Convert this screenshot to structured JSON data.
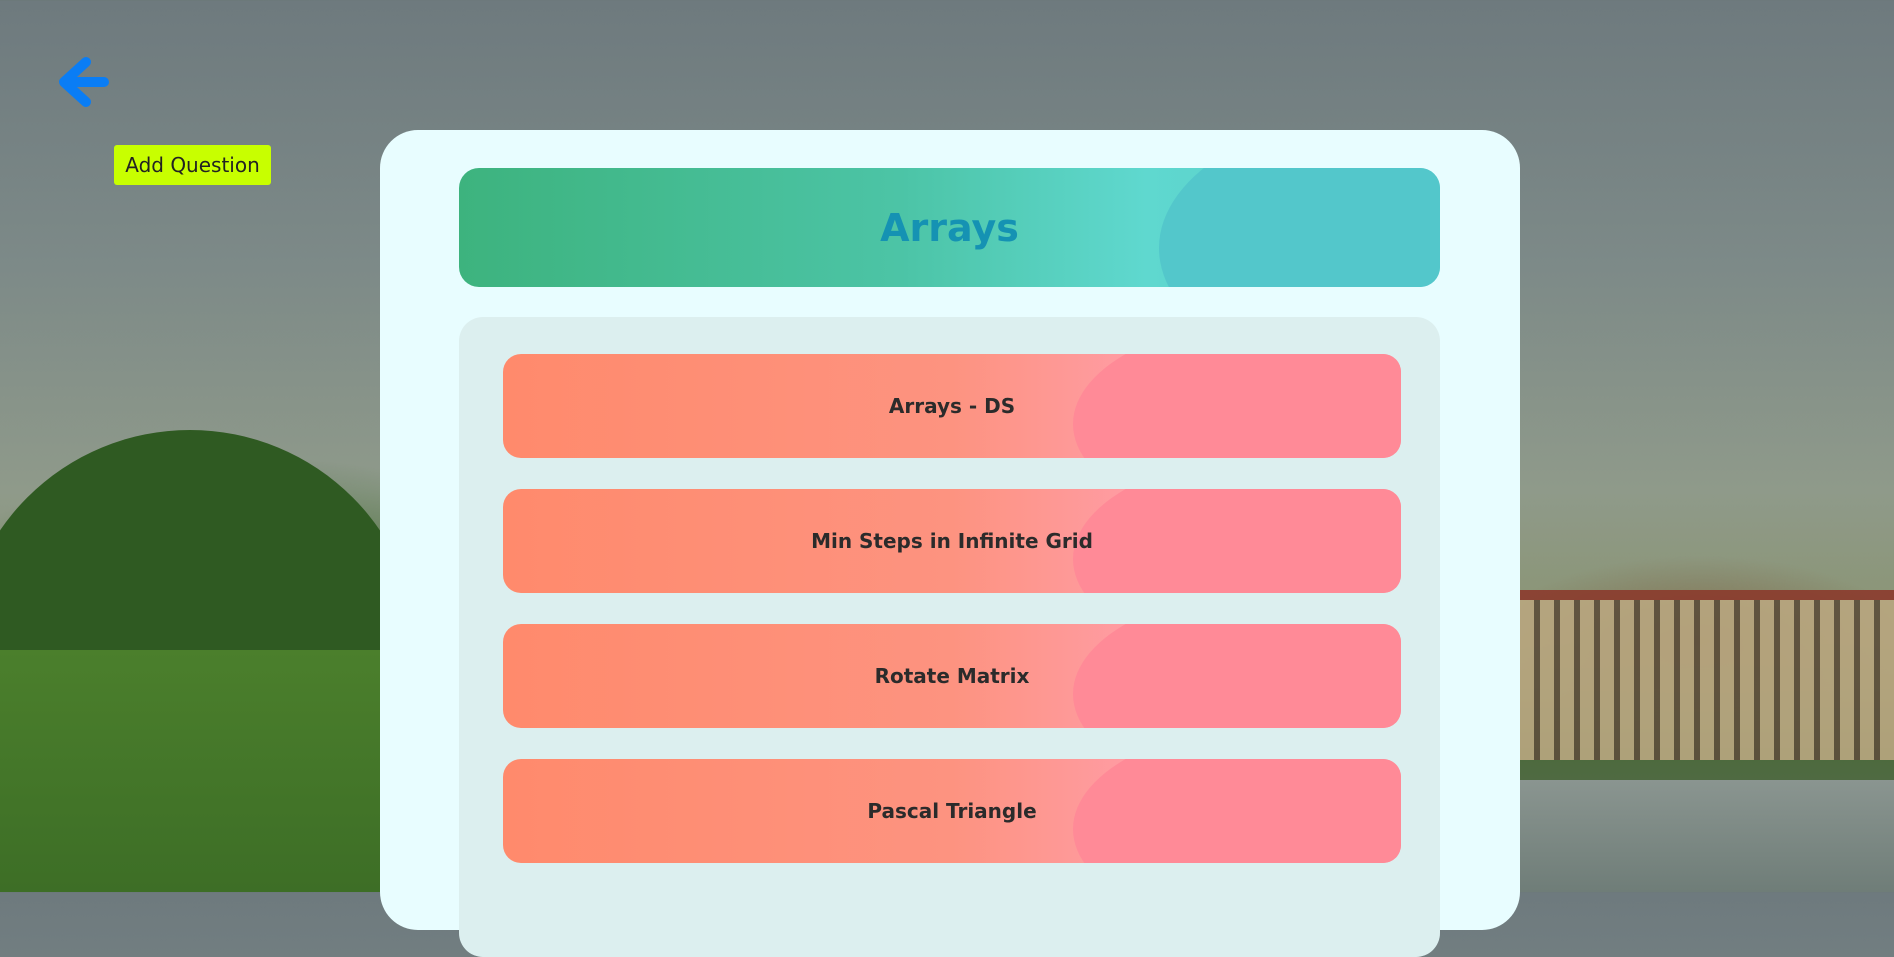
{
  "nav": {
    "back_icon": "arrow-left-icon",
    "add_question_label": "Add Question"
  },
  "colors": {
    "back_icon": "#0a7df5",
    "add_button": "#c8ff00",
    "title": "#1592b3"
  },
  "topic": {
    "title": "Arrays"
  },
  "questions": [
    {
      "label": "Arrays - DS"
    },
    {
      "label": "Min Steps in Infinite Grid"
    },
    {
      "label": "Rotate Matrix"
    },
    {
      "label": "Pascal Triangle"
    }
  ]
}
